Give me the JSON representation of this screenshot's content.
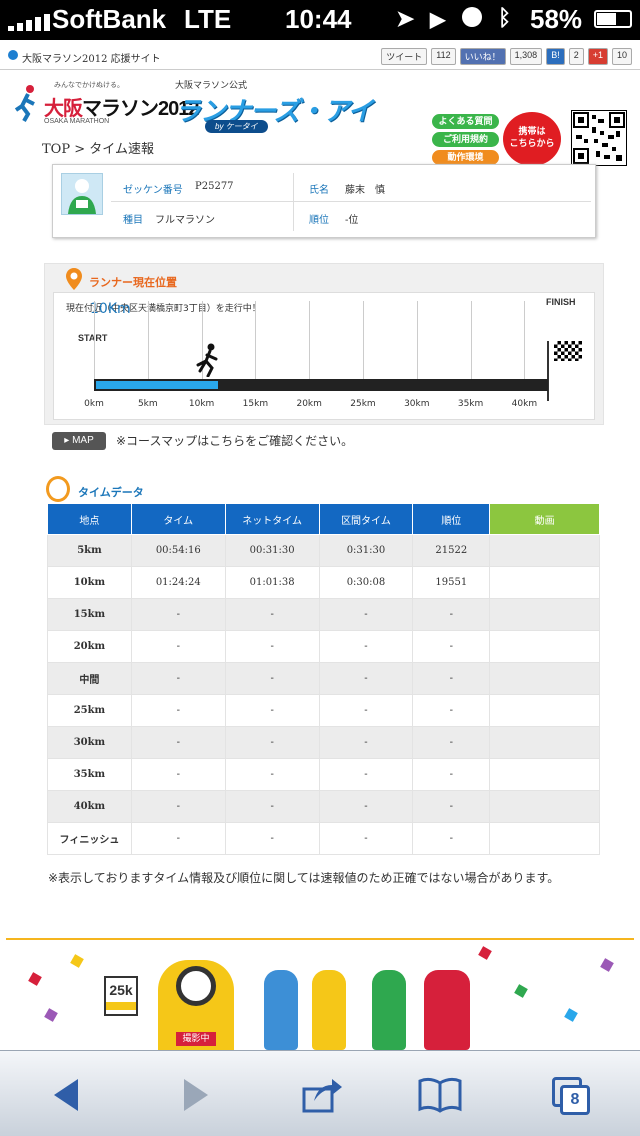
{
  "status": {
    "carrier": "SoftBank",
    "network": "LTE",
    "time": "10:44",
    "battery": "58%"
  },
  "top": {
    "site_title": "大阪マラソン2012 応援サイト",
    "tweet": "ツイート",
    "tweet_count": "112",
    "like": "いいね！",
    "like_count": "1,308",
    "hatena": "B!",
    "hatena_count": "2",
    "gplus": "+1",
    "gplus_count": "10"
  },
  "logos": {
    "osaka_tagline": "みんなでかけぬける。",
    "osaka_name_a": "大阪",
    "osaka_name_b": "マラソン2012",
    "osaka_sub": "OSAKA MARATHON",
    "rx_pre": "大阪マラソン公式",
    "rx_name": "ランナーズ・アイ",
    "rx_by": "by ケータイ"
  },
  "links": {
    "faq": "よくある質問",
    "terms": "ご利用規約",
    "env": "動作環境",
    "mobile_1": "携帯は",
    "mobile_2": "こちらから"
  },
  "breadcrumb": "TOP > タイム速報",
  "runner": {
    "bib_label": "ゼッケン番号",
    "bib": "P25277",
    "name_label": "氏名",
    "name": "藤末　慎",
    "event_label": "種目",
    "event": "フルマラソン",
    "rank_label": "順位",
    "rank": "-位"
  },
  "position": {
    "title": "ランナー現在位置",
    "now_prefix": "現在",
    "now_km": "10Km",
    "now_suffix": "付近（中央区天満橋京町3丁目）を走行中！",
    "start": "START",
    "finish": "FINISH",
    "progress_km": 11.3,
    "total_km": 42.195,
    "km_labels": [
      "0km",
      "5km",
      "10km",
      "15km",
      "20km",
      "25km",
      "30km",
      "35km",
      "40km"
    ]
  },
  "map": {
    "button": "MAP",
    "note": "※コースマップはこちらをご確認ください。"
  },
  "timedata": {
    "title": "タイムデータ",
    "headers": [
      "地点",
      "タイム",
      "ネットタイム",
      "区間タイム",
      "順位",
      "動画"
    ],
    "rows": [
      [
        "5km",
        "00:54:16",
        "00:31:30",
        "0:31:30",
        "21522",
        ""
      ],
      [
        "10km",
        "01:24:24",
        "01:01:38",
        "0:30:08",
        "19551",
        ""
      ],
      [
        "15km",
        "-",
        "-",
        "-",
        "-",
        ""
      ],
      [
        "20km",
        "-",
        "-",
        "-",
        "-",
        ""
      ],
      [
        "中間",
        "-",
        "-",
        "-",
        "-",
        ""
      ],
      [
        "25km",
        "-",
        "-",
        "-",
        "-",
        ""
      ],
      [
        "30km",
        "-",
        "-",
        "-",
        "-",
        ""
      ],
      [
        "35km",
        "-",
        "-",
        "-",
        "-",
        ""
      ],
      [
        "40km",
        "-",
        "-",
        "-",
        "-",
        ""
      ],
      [
        "フィニッシュ",
        "-",
        "-",
        "-",
        "-",
        ""
      ]
    ]
  },
  "disclaimer": "※表示しておりますタイム情報及び順位に関しては速報値のため正確ではない場合があります。",
  "banner": {
    "sign": "25k",
    "mascot_tag": "撮影中"
  },
  "browser": {
    "tabs": "8"
  },
  "colors": {
    "primary_blue": "#1368c2",
    "green": "#8cc63f",
    "orange": "#e8681f",
    "track_fill": "#2aa7ea"
  }
}
